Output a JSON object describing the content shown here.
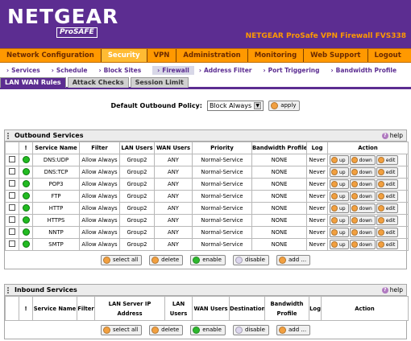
{
  "header": {
    "logo": "NETGEAR",
    "logo_sub": "ProSAFE",
    "product_title": "NETGEAR ProSafe VPN Firewall FVS338"
  },
  "main_nav": {
    "items": [
      {
        "label": "Network Configuration"
      },
      {
        "label": "Security"
      },
      {
        "label": "VPN"
      },
      {
        "label": "Administration"
      },
      {
        "label": "Monitoring"
      },
      {
        "label": "Web Support"
      },
      {
        "label": "Logout"
      }
    ],
    "active_index": 1
  },
  "sub_nav": {
    "items": [
      {
        "label": "Services"
      },
      {
        "label": "Schedule"
      },
      {
        "label": "Block Sites"
      },
      {
        "label": "Firewall"
      },
      {
        "label": "Address Filter"
      },
      {
        "label": "Port Triggering"
      },
      {
        "label": "Bandwidth Profile"
      }
    ],
    "active_index": 3
  },
  "tabs": [
    {
      "label": "LAN WAN Rules"
    },
    {
      "label": "Attack Checks"
    },
    {
      "label": "Session Limit"
    }
  ],
  "policy": {
    "label": "Default Outbound Policy:",
    "selected": "Block Always",
    "apply_label": "apply"
  },
  "outbound": {
    "title": "Outbound Services",
    "help_label": "help",
    "headers": [
      "!",
      "Service Name",
      "Filter",
      "LAN Users",
      "WAN Users",
      "Priority",
      "Bandwidth Profile",
      "Log",
      "Action"
    ],
    "rows": [
      {
        "service": "DNS:UDP",
        "filter": "Allow Always",
        "lan": "Group2",
        "wan": "ANY",
        "priority": "Normal-Service",
        "bw": "NONE",
        "log": "Never"
      },
      {
        "service": "DNS:TCP",
        "filter": "Allow Always",
        "lan": "Group2",
        "wan": "ANY",
        "priority": "Normal-Service",
        "bw": "NONE",
        "log": "Never"
      },
      {
        "service": "POP3",
        "filter": "Allow Always",
        "lan": "Group2",
        "wan": "ANY",
        "priority": "Normal-Service",
        "bw": "NONE",
        "log": "Never"
      },
      {
        "service": "FTP",
        "filter": "Allow Always",
        "lan": "Group2",
        "wan": "ANY",
        "priority": "Normal-Service",
        "bw": "NONE",
        "log": "Never"
      },
      {
        "service": "HTTP",
        "filter": "Allow Always",
        "lan": "Group2",
        "wan": "ANY",
        "priority": "Normal-Service",
        "bw": "NONE",
        "log": "Never"
      },
      {
        "service": "HTTPS",
        "filter": "Allow Always",
        "lan": "Group2",
        "wan": "ANY",
        "priority": "Normal-Service",
        "bw": "NONE",
        "log": "Never"
      },
      {
        "service": "NNTP",
        "filter": "Allow Always",
        "lan": "Group2",
        "wan": "ANY",
        "priority": "Normal-Service",
        "bw": "NONE",
        "log": "Never"
      },
      {
        "service": "SMTP",
        "filter": "Allow Always",
        "lan": "Group2",
        "wan": "ANY",
        "priority": "Normal-Service",
        "bw": "NONE",
        "log": "Never"
      }
    ],
    "row_actions": {
      "up": "up",
      "down": "down",
      "edit": "edit"
    },
    "buttons": {
      "select_all": "select all",
      "delete": "delete",
      "enable": "enable",
      "disable": "disable",
      "add": "add ..."
    }
  },
  "inbound": {
    "title": "Inbound Services",
    "help_label": "help",
    "headers": [
      "!",
      "Service Name",
      "Filter",
      "LAN Server IP Address",
      "LAN Users",
      "WAN Users",
      "Destination",
      "Bandwidth Profile",
      "Log",
      "Action"
    ],
    "buttons": {
      "select_all": "select all",
      "delete": "delete",
      "enable": "enable",
      "disable": "disable",
      "add": "add ..."
    }
  },
  "colors": {
    "header_bg": "#5c2d91",
    "nav_bg": "#ff9900",
    "product_title": "#ff9900",
    "status_enabled": "#22bb22"
  }
}
